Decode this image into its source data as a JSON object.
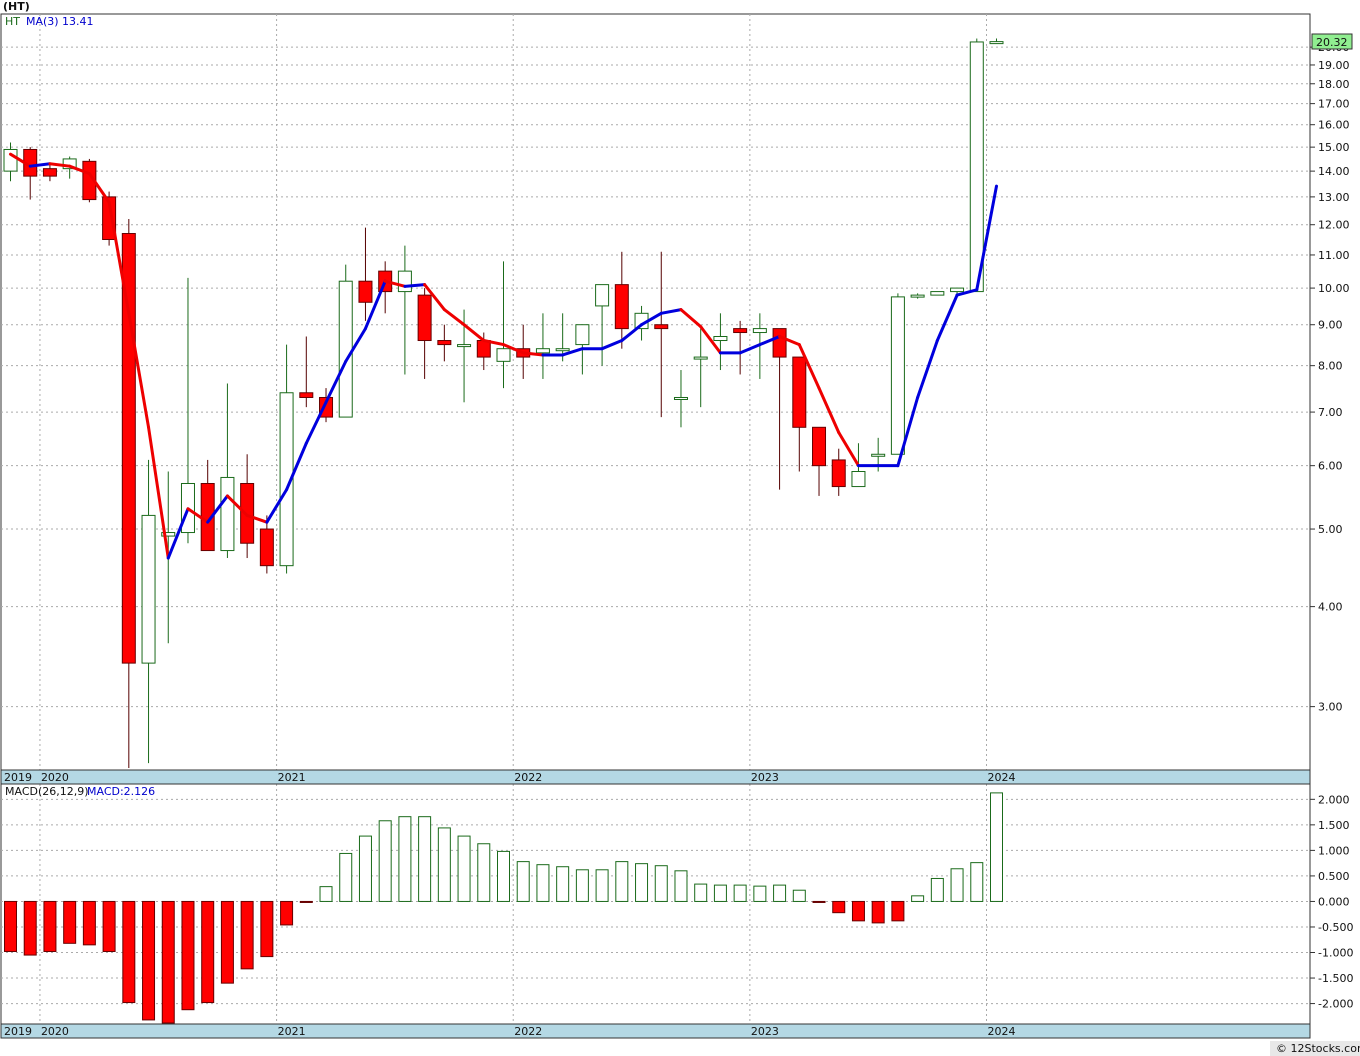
{
  "page": {
    "title": "(HT)",
    "watermark": "© 12Stocks.com"
  },
  "price_panel": {
    "legend_symbol": "HT",
    "legend_ma_label": "MA(3)",
    "legend_ma_value": "13.41",
    "last_price_label": "20.32",
    "y_tick_labels": [
      "20.00",
      "19.00",
      "18.00",
      "17.00",
      "16.00",
      "15.00",
      "14.00",
      "13.00",
      "12.00",
      "11.00",
      "10.00",
      "9.00",
      "8.00",
      "7.00",
      "6.00",
      "5.00",
      "4.00",
      "3.00"
    ]
  },
  "macd_panel": {
    "legend_label": "MACD(26,12,9)",
    "legend_value": "MACD:2.126",
    "y_tick_labels": [
      "2.000",
      "1.500",
      "1.000",
      "0.500",
      "0.000",
      "-0.500",
      "-1.000",
      "-1.500",
      "-2.000"
    ]
  },
  "x_axis": {
    "labels": [
      "2019",
      "2020",
      "2021",
      "2022",
      "2023",
      "2024"
    ]
  },
  "colors": {
    "up_fill": "#ffffff",
    "up_stroke": "#1a6a1a",
    "down_fill": "#ff0000",
    "ma_up": "#0000dd",
    "ma_down": "#ee0000",
    "axis_band": "#b4d8e4",
    "grid": "#aaaaaa",
    "last_price_bg": "#90ee90"
  },
  "chart_data": [
    {
      "type": "candlestick",
      "title": "(HT)",
      "scale": "log",
      "ylim": [
        2.5,
        22
      ],
      "frequency": "monthly",
      "x": [
        "2019-11",
        "2019-12",
        "2020-01",
        "2020-02",
        "2020-03",
        "2020-04",
        "2020-05",
        "2020-06",
        "2020-07",
        "2020-08",
        "2020-09",
        "2020-10",
        "2020-11",
        "2020-12",
        "2021-01",
        "2021-02",
        "2021-03",
        "2021-04",
        "2021-05",
        "2021-06",
        "2021-07",
        "2021-08",
        "2021-09",
        "2021-10",
        "2021-11",
        "2021-12",
        "2022-01",
        "2022-02",
        "2022-03",
        "2022-04",
        "2022-05",
        "2022-06",
        "2022-07",
        "2022-08",
        "2022-09",
        "2022-10",
        "2022-11",
        "2022-12",
        "2023-01",
        "2023-02",
        "2023-03",
        "2023-04",
        "2023-05",
        "2023-06",
        "2023-07",
        "2023-08",
        "2023-09",
        "2023-10",
        "2023-11",
        "2023-12",
        "2024-01"
      ],
      "open": [
        14.0,
        14.9,
        14.1,
        14.1,
        14.4,
        13.0,
        11.7,
        3.4,
        4.9,
        4.95,
        5.7,
        4.7,
        5.7,
        5.0,
        4.5,
        7.4,
        7.3,
        6.9,
        10.2,
        10.5,
        9.9,
        9.8,
        8.6,
        8.5,
        8.6,
        8.1,
        8.4,
        8.3,
        8.4,
        8.5,
        9.5,
        10.1,
        8.9,
        9.0,
        7.3,
        8.2,
        8.6,
        8.9,
        8.8,
        8.9,
        8.2,
        6.7,
        6.1,
        5.65,
        6.2,
        6.2,
        9.75,
        9.8,
        9.9,
        9.9,
        20.3
      ],
      "high": [
        15.2,
        15.0,
        14.3,
        14.6,
        14.5,
        13.2,
        12.2,
        6.1,
        5.9,
        10.3,
        6.1,
        7.6,
        6.2,
        5.2,
        8.5,
        8.7,
        7.5,
        10.7,
        11.9,
        10.8,
        11.3,
        10.0,
        9.0,
        9.4,
        8.8,
        10.8,
        9.0,
        9.3,
        9.3,
        8.8,
        10.1,
        11.1,
        9.5,
        11.1,
        7.9,
        8.9,
        9.3,
        9.1,
        9.3,
        8.4,
        6.8,
        6.3,
        6.3,
        6.4,
        6.5,
        9.85,
        9.85,
        9.9,
        10.0,
        20.5,
        20.5
      ],
      "high_note": "",
      "low": [
        13.6,
        12.9,
        13.6,
        13.7,
        12.8,
        11.3,
        2.45,
        2.55,
        3.6,
        4.8,
        4.7,
        4.6,
        4.6,
        4.4,
        4.4,
        7.1,
        6.8,
        6.9,
        9.1,
        9.3,
        7.8,
        7.7,
        8.1,
        7.2,
        7.9,
        7.5,
        7.7,
        7.7,
        8.1,
        7.8,
        8.0,
        8.4,
        8.6,
        6.9,
        6.7,
        7.1,
        7.9,
        7.8,
        7.7,
        5.6,
        5.9,
        5.5,
        5.5,
        5.9,
        5.9,
        9.6,
        9.7,
        9.8,
        9.8,
        20.2,
        20.2
      ],
      "close": [
        14.9,
        13.8,
        13.8,
        14.5,
        12.9,
        11.5,
        3.4,
        5.2,
        4.95,
        5.7,
        4.7,
        5.8,
        4.8,
        4.5,
        7.4,
        7.3,
        6.9,
        10.2,
        9.6,
        9.9,
        10.5,
        8.6,
        8.5,
        8.5,
        8.2,
        8.4,
        8.2,
        8.4,
        8.4,
        9.0,
        10.1,
        8.9,
        9.3,
        8.9,
        7.3,
        8.2,
        8.7,
        8.8,
        8.9,
        8.2,
        6.7,
        6.0,
        5.65,
        5.9,
        6.2,
        9.75,
        9.8,
        9.9,
        10.0,
        20.3,
        20.32
      ],
      "ma3": [
        14.7,
        14.2,
        14.3,
        14.2,
        13.9,
        12.8,
        9.3,
        6.7,
        4.6,
        5.3,
        5.1,
        5.5,
        5.2,
        5.1,
        5.6,
        6.4,
        7.2,
        8.1,
        8.9,
        10.2,
        10.05,
        10.1,
        9.4,
        9.0,
        8.6,
        8.5,
        8.3,
        8.25,
        8.25,
        8.4,
        8.4,
        8.6,
        9.0,
        9.3,
        9.4,
        8.95,
        8.3,
        8.3,
        8.5,
        8.7,
        8.5,
        7.5,
        6.6,
        6.0,
        6.0,
        6.0,
        7.3,
        8.6,
        9.8,
        9.95,
        13.41
      ],
      "series": [
        {
          "name": "HT"
        },
        {
          "name": "MA(3)"
        }
      ]
    },
    {
      "type": "bar",
      "title": "MACD(26,12,9)",
      "ylim": [
        -2.4,
        2.3
      ],
      "x": [
        "2019-11",
        "2019-12",
        "2020-01",
        "2020-02",
        "2020-03",
        "2020-04",
        "2020-05",
        "2020-06",
        "2020-07",
        "2020-08",
        "2020-09",
        "2020-10",
        "2020-11",
        "2020-12",
        "2021-01",
        "2021-02",
        "2021-03",
        "2021-04",
        "2021-05",
        "2021-06",
        "2021-07",
        "2021-08",
        "2021-09",
        "2021-10",
        "2021-11",
        "2021-12",
        "2022-01",
        "2022-02",
        "2022-03",
        "2022-04",
        "2022-05",
        "2022-06",
        "2022-07",
        "2022-08",
        "2022-09",
        "2022-10",
        "2022-11",
        "2022-12",
        "2023-01",
        "2023-02",
        "2023-03",
        "2023-04",
        "2023-05",
        "2023-06",
        "2023-07",
        "2023-08",
        "2023-09",
        "2023-10",
        "2023-11",
        "2023-12",
        "2024-01"
      ],
      "values": [
        -0.98,
        -1.05,
        -0.98,
        -0.82,
        -0.85,
        -0.98,
        -1.98,
        -2.32,
        -2.38,
        -2.12,
        -1.98,
        -1.6,
        -1.32,
        -1.08,
        -0.46,
        -0.02,
        0.29,
        0.94,
        1.28,
        1.58,
        1.66,
        1.66,
        1.44,
        1.28,
        1.13,
        0.98,
        0.78,
        0.72,
        0.68,
        0.62,
        0.62,
        0.78,
        0.74,
        0.7,
        0.6,
        0.34,
        0.32,
        0.32,
        0.3,
        0.32,
        0.22,
        -0.02,
        -0.22,
        -0.38,
        -0.42,
        -0.38,
        0.11,
        0.45,
        0.64,
        0.76,
        2.126
      ],
      "series": [
        {
          "name": "MACD"
        }
      ]
    }
  ]
}
